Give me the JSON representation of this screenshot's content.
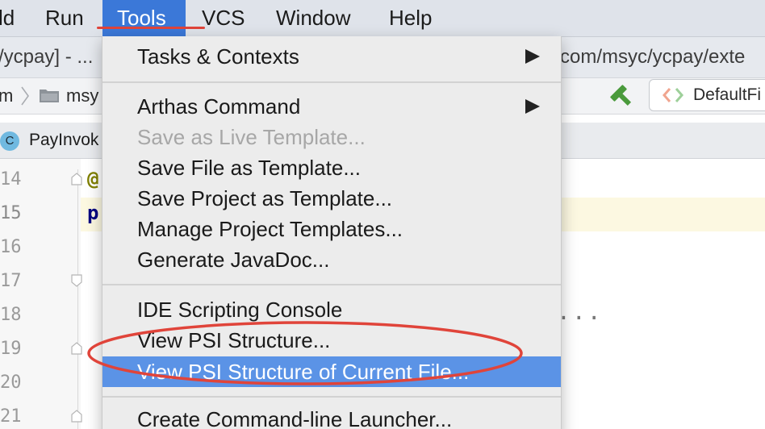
{
  "menubar": {
    "items": [
      {
        "label": "ld"
      },
      {
        "label": "Run"
      },
      {
        "label": "Tools"
      },
      {
        "label": "VCS"
      },
      {
        "label": "Window"
      },
      {
        "label": "Help"
      }
    ]
  },
  "titlebar": {
    "left_text": "/ycpay] - ...",
    "right_text": "com/msyc/ycpay/exte"
  },
  "navbar": {
    "crumb_1": "m",
    "crumb_2": "msy",
    "run_config_label": "DefaultFi"
  },
  "tabbar": {
    "class_icon_letter": "C",
    "tab_label": "PayInvok"
  },
  "editor": {
    "line_numbers": [
      "14",
      "15",
      "16",
      "17",
      "18",
      "19",
      "20",
      "21"
    ],
    "code_at": "@",
    "code_p": "p",
    "ellipsis": "..."
  },
  "tools_menu": {
    "items": [
      {
        "label": "Tasks & Contexts",
        "submenu": true
      },
      {
        "label": "Arthas Command",
        "submenu": true
      },
      {
        "label": "Save as Live Template...",
        "disabled": true
      },
      {
        "label": "Save File as Template..."
      },
      {
        "label": "Save Project as Template..."
      },
      {
        "label": "Manage Project Templates..."
      },
      {
        "label": "Generate JavaDoc..."
      },
      {
        "label": "IDE Scripting Console"
      },
      {
        "label": "View PSI Structure..."
      },
      {
        "label": "View PSI Structure of Current File...",
        "selected": true
      },
      {
        "label": "Create Command-line Launcher..."
      }
    ]
  },
  "colors": {
    "active_menu": "#3b78d8",
    "selected_item": "#5b93e6",
    "annotation_red": "#e0443a",
    "hammer_green": "#4a9a3c"
  }
}
